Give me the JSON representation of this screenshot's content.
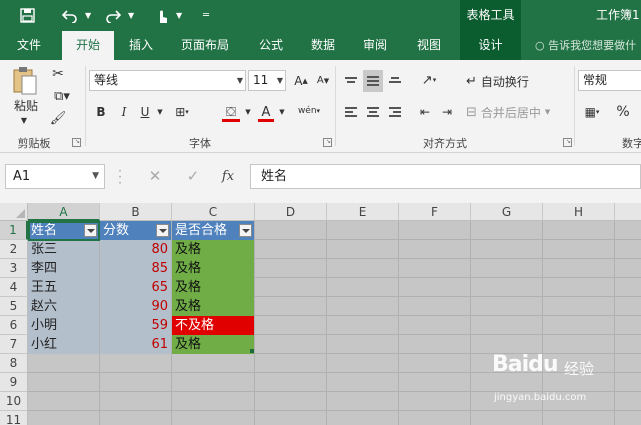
{
  "titlebar": {
    "context_group": "表格工具",
    "window_title": "工作簿1"
  },
  "tabs": {
    "file": "文件",
    "home": "开始",
    "insert": "插入",
    "layout": "页面布局",
    "formulas": "公式",
    "data": "数据",
    "review": "审阅",
    "view": "视图",
    "design": "设计",
    "tell_me": "告诉我您想要做什"
  },
  "ribbon": {
    "clipboard": {
      "paste": "粘贴",
      "label": "剪贴板"
    },
    "font": {
      "name": "等线",
      "size": "11",
      "bold": "B",
      "italic": "I",
      "underline": "U",
      "wen": "wén",
      "label": "字体"
    },
    "alignment": {
      "wrap": "自动换行",
      "merge": "合并后居中",
      "label": "对齐方式"
    },
    "number": {
      "format": "常规",
      "percent": "%",
      "label": "数字"
    }
  },
  "formula_bar": {
    "name_box": "A1",
    "content": "姓名"
  },
  "sheet": {
    "columns": [
      "A",
      "B",
      "C",
      "D",
      "E",
      "F",
      "G",
      "H"
    ],
    "rows": [
      "1",
      "2",
      "3",
      "4",
      "5",
      "6",
      "7",
      "8",
      "9",
      "10",
      "11"
    ],
    "headers": [
      "姓名",
      "分数",
      "是否合格"
    ],
    "data": [
      {
        "name": "张三",
        "score": "80",
        "result": "及格",
        "status": "pass"
      },
      {
        "name": "李四",
        "score": "85",
        "result": "及格",
        "status": "pass"
      },
      {
        "name": "王五",
        "score": "65",
        "result": "及格",
        "status": "pass"
      },
      {
        "name": "赵六",
        "score": "90",
        "result": "及格",
        "status": "pass"
      },
      {
        "name": "小明",
        "score": "59",
        "result": "不及格",
        "status": "fail"
      },
      {
        "name": "小红",
        "score": "61",
        "result": "及格",
        "status": "pass"
      }
    ]
  },
  "watermark": {
    "brand": "Baidu",
    "brand_cn": "经验",
    "url": "jingyan.baidu.com"
  },
  "colors": {
    "excel_green": "#217346",
    "table_header": "#4f81bd",
    "pass": "#70ad47",
    "fail": "#e00000",
    "score_text": "#c00000"
  }
}
